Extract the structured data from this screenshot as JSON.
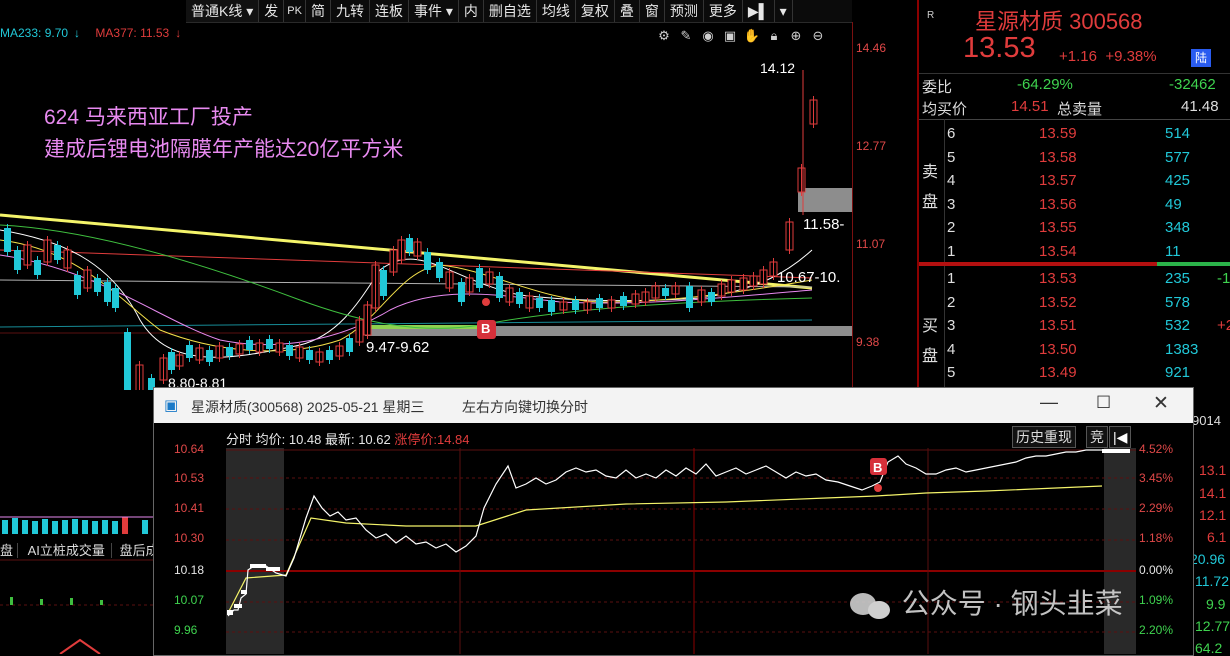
{
  "toolbar": {
    "items": [
      "普通K线",
      "发",
      "PK",
      "简",
      "九转",
      "连板",
      "事件",
      "内",
      "删自选",
      "均线",
      "复权",
      "叠",
      "窗",
      "预测",
      "更多"
    ]
  },
  "ma": {
    "ma233": "MA233: 9.70",
    "ma233_arrow": "↓",
    "ma377": "MA377: 11.53",
    "ma377_arrow": "↓"
  },
  "axis": {
    "price_labels": [
      "14.46",
      "12.77",
      "11.07",
      "9.38"
    ]
  },
  "annotation": {
    "line1": "624  马来西亚工厂投产",
    "line2": "建成后锂电池隔膜年产能达20亿平方米"
  },
  "chart_labels": {
    "high": "14.12",
    "zone1": "11.58-",
    "zone2": "10.67-10.",
    "zone3": "9.47-9.62",
    "zone4": "8.80-8.81",
    "signal": "B"
  },
  "quote": {
    "market_tag": "R",
    "name_code": "星源材质 300568",
    "price": "13.53",
    "change": "+1.16",
    "change_pct": "+9.38%",
    "badge": "陆",
    "weibi_label": "委比",
    "weibi_pct": "-64.29%",
    "weibi_val": "-32462",
    "avg_label": "均买价",
    "avg_val": "14.51",
    "vol_label": "总卖量",
    "vol_val": "41.48",
    "sell_side": "卖\n盘",
    "buy_side": "买\n盘",
    "asks": [
      {
        "lvl": "6",
        "price": "13.59",
        "vol": "514"
      },
      {
        "lvl": "5",
        "price": "13.58",
        "vol": "577"
      },
      {
        "lvl": "4",
        "price": "13.57",
        "vol": "425"
      },
      {
        "lvl": "3",
        "price": "13.56",
        "vol": "49"
      },
      {
        "lvl": "2",
        "price": "13.55",
        "vol": "348"
      },
      {
        "lvl": "1",
        "price": "13.54",
        "vol": "11"
      }
    ],
    "bids": [
      {
        "lvl": "1",
        "price": "13.53",
        "vol": "235",
        "extra": "-1"
      },
      {
        "lvl": "2",
        "price": "13.52",
        "vol": "578",
        "extra": ""
      },
      {
        "lvl": "3",
        "price": "13.51",
        "vol": "532",
        "extra": "+2"
      },
      {
        "lvl": "4",
        "price": "13.50",
        "vol": "1383",
        "extra": ""
      },
      {
        "lvl": "5",
        "price": "13.49",
        "vol": "921",
        "extra": ""
      }
    ],
    "partial_right": [
      "9014",
      "13.1",
      "14.1",
      "12.1",
      "6.1",
      "20.96",
      "11.72",
      "9.9",
      "12.77",
      "64.2"
    ]
  },
  "popup": {
    "title": "星源材质(300568) 2025-05-21 星期三",
    "hint": "左右方向键切换分时",
    "info_prefix": "分时 均价: 10.48 最新: 10.62",
    "info_limit": "涨停价:14.84",
    "btn_history": "历史重现",
    "btn_short": "竞",
    "left_labels": [
      "10.64",
      "10.53",
      "10.41",
      "10.30",
      "10.18",
      "10.07",
      "9.96"
    ],
    "right_labels": [
      "4.52%",
      "3.45%",
      "2.29%",
      "1.18%",
      "0.00%",
      "1.09%",
      "2.20%"
    ],
    "signal": "B"
  },
  "bottom_left": {
    "tab1": "盘",
    "tab2": "AI立桩成交量",
    "tab3": "盘后成"
  },
  "watermark": "公众号 · 钢头韭菜",
  "colors": {
    "up": "#e03c3c",
    "down": "#21c8d8",
    "yellow": "#f4f46a",
    "pink": "#e88af0"
  }
}
